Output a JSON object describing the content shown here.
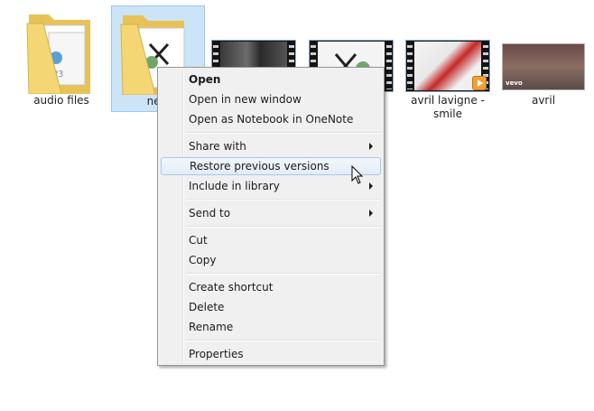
{
  "files": [
    {
      "id": "audio-files",
      "label": "audio files",
      "type": "folder"
    },
    {
      "id": "new",
      "label": "new",
      "type": "folder",
      "selected": true
    },
    {
      "id": "video-1",
      "label": "",
      "type": "video"
    },
    {
      "id": "video-2",
      "label": "",
      "type": "video"
    },
    {
      "id": "avril-lavigne-smile",
      "label": "avril lavigne - smile",
      "type": "video"
    },
    {
      "id": "avril",
      "label": "avril",
      "type": "video"
    }
  ],
  "video_watermark": "vevo",
  "context_menu": {
    "items": [
      {
        "label": "Open",
        "bold": true
      },
      {
        "label": "Open in new window"
      },
      {
        "label": "Open as Notebook in OneNote"
      },
      {
        "label": "Share with",
        "submenu": true
      },
      {
        "label": "Restore previous versions",
        "hover": true
      },
      {
        "label": "Include in library",
        "submenu": true
      },
      {
        "label": "Send to",
        "submenu": true
      },
      {
        "label": "Cut"
      },
      {
        "label": "Copy"
      },
      {
        "label": "Create shortcut"
      },
      {
        "label": "Delete"
      },
      {
        "label": "Rename"
      },
      {
        "label": "Properties"
      }
    ]
  },
  "colors": {
    "selection_fill": "#cce4f7",
    "selection_border": "#99c9ef",
    "menu_bg": "#f0f0f0",
    "hover_border": "#a8c8ea",
    "folder": "#f4d774"
  }
}
